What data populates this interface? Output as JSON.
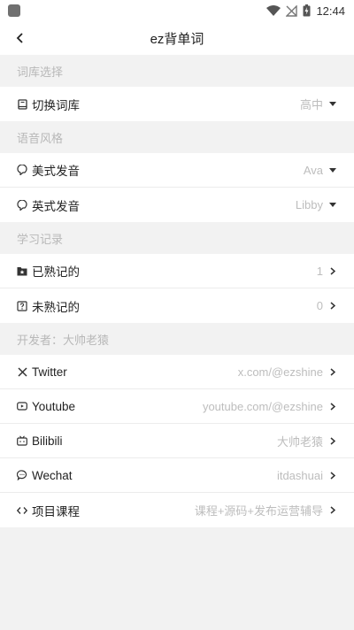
{
  "status": {
    "time": "12:44"
  },
  "appbar": {
    "title": "ez背单词"
  },
  "sections": [
    {
      "header": "词库选择",
      "items": [
        {
          "label": "切换词库",
          "value": "高中"
        }
      ]
    },
    {
      "header": "语音风格",
      "items": [
        {
          "label": "美式发音",
          "value": "Ava"
        },
        {
          "label": "英式发音",
          "value": "Libby"
        }
      ]
    },
    {
      "header": "学习记录",
      "items": [
        {
          "label": "已熟记的",
          "value": "1"
        },
        {
          "label": "未熟记的",
          "value": "0"
        }
      ]
    },
    {
      "header": "开发者：大帅老猿",
      "items": [
        {
          "label": "Twitter",
          "value": "x.com/@ezshine"
        },
        {
          "label": "Youtube",
          "value": "youtube.com/@ezshine"
        },
        {
          "label": "Bilibili",
          "value": "大帅老猿"
        },
        {
          "label": "Wechat",
          "value": "itdashuai"
        },
        {
          "label": "项目课程",
          "value": "课程+源码+发布运营辅导"
        }
      ]
    }
  ]
}
